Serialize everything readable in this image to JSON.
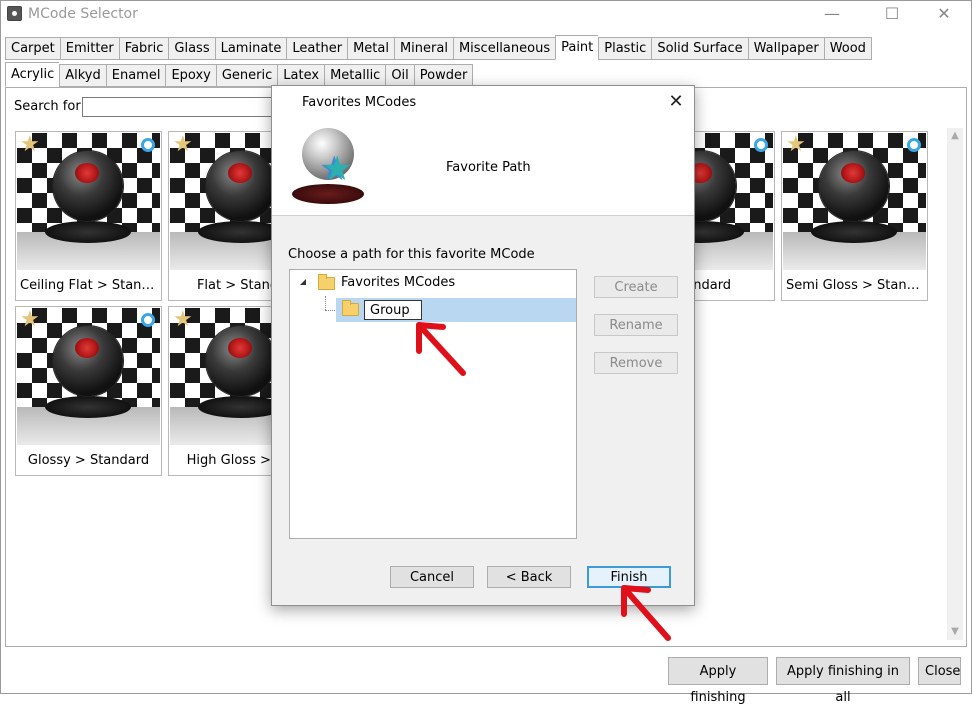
{
  "window": {
    "title": "MCode Selector",
    "controls": {
      "minimize": "—",
      "maximize": "☐",
      "close": "✕"
    }
  },
  "categories": [
    {
      "label": "Carpet",
      "active": false
    },
    {
      "label": "Emitter",
      "active": false
    },
    {
      "label": "Fabric",
      "active": false
    },
    {
      "label": "Glass",
      "active": false
    },
    {
      "label": "Laminate",
      "active": false
    },
    {
      "label": "Leather",
      "active": false
    },
    {
      "label": "Metal",
      "active": false
    },
    {
      "label": "Mineral",
      "active": false
    },
    {
      "label": "Miscellaneous",
      "active": false
    },
    {
      "label": "Paint",
      "active": true
    },
    {
      "label": "Plastic",
      "active": false
    },
    {
      "label": "Solid Surface",
      "active": false
    },
    {
      "label": "Wallpaper",
      "active": false
    },
    {
      "label": "Wood",
      "active": false
    }
  ],
  "subcategories": [
    {
      "label": "Acrylic",
      "active": true
    },
    {
      "label": "Alkyd",
      "active": false
    },
    {
      "label": "Enamel",
      "active": false
    },
    {
      "label": "Epoxy",
      "active": false
    },
    {
      "label": "Generic",
      "active": false
    },
    {
      "label": "Latex",
      "active": false
    },
    {
      "label": "Metallic",
      "active": false
    },
    {
      "label": "Oil",
      "active": false
    },
    {
      "label": "Powder",
      "active": false
    }
  ],
  "search": {
    "label": "Search for:",
    "value": ""
  },
  "cards": [
    {
      "label": "Ceiling Flat > Standa...",
      "badge": true
    },
    {
      "label": "Flat > Standa",
      "badge": false
    },
    {
      "label": "Standard",
      "badge": true
    },
    {
      "label": "Semi Gloss > Standard",
      "badge": true
    },
    {
      "label": "Glossy > Standard",
      "badge": true
    },
    {
      "label": "High Gloss > Sta",
      "badge": false
    }
  ],
  "footer": {
    "apply": "Apply finishing",
    "apply_all": "Apply finishing in all",
    "close": "Close"
  },
  "dialog": {
    "title": "Favorites MCodes",
    "close_glyph": "✕",
    "subtitle": "Favorite Path",
    "prompt": "Choose a path for this favorite MCode",
    "tree": {
      "root": "Favorites MCodes",
      "child_edit_value": "Group"
    },
    "side_buttons": {
      "create": "Create",
      "rename": "Rename",
      "remove": "Remove"
    },
    "buttons": {
      "cancel": "Cancel",
      "back": "< Back",
      "finish": "Finish"
    }
  },
  "colors": {
    "accent": "#3c9ad8",
    "selection": "#b9d7f0",
    "annotation_arrow": "#e0101a",
    "star": "#e4c57a"
  }
}
